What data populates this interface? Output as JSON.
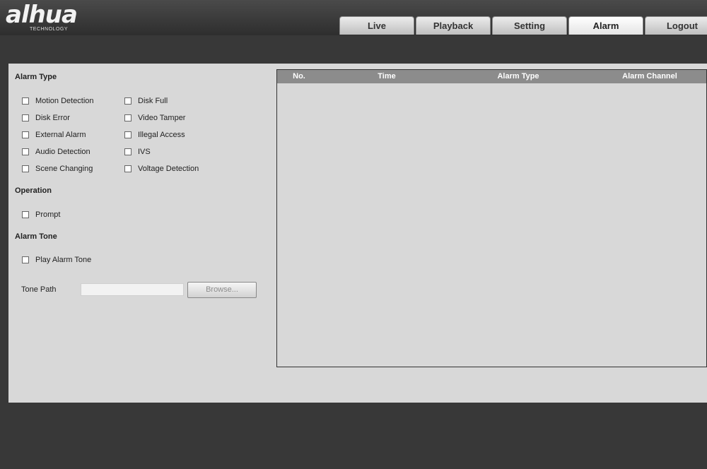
{
  "header": {
    "logo_text": "alhua",
    "logo_sub": "TECHNOLOGY",
    "tabs": [
      {
        "label": "Live"
      },
      {
        "label": "Playback"
      },
      {
        "label": "Setting"
      },
      {
        "label": "Alarm",
        "active": true
      },
      {
        "label": "Logout"
      }
    ]
  },
  "alarm_type": {
    "title": "Alarm Type",
    "left": [
      "Motion Detection",
      "Disk Error",
      "External Alarm",
      "Audio Detection",
      "Scene Changing"
    ],
    "right": [
      "Disk Full",
      "Video Tamper",
      "Illegal Access",
      "IVS",
      "Voltage Detection"
    ]
  },
  "operation": {
    "title": "Operation",
    "prompt": "Prompt"
  },
  "alarm_tone": {
    "title": "Alarm Tone",
    "play": "Play Alarm Tone",
    "path_label": "Tone Path",
    "path_value": "",
    "browse": "Browse..."
  },
  "table": {
    "columns": [
      "No.",
      "Time",
      "Alarm Type",
      "Alarm Channel"
    ],
    "rows": []
  },
  "colors": {
    "background": "#383838",
    "panel": "#d8d8d8",
    "table_header": "#8c8c8c"
  }
}
